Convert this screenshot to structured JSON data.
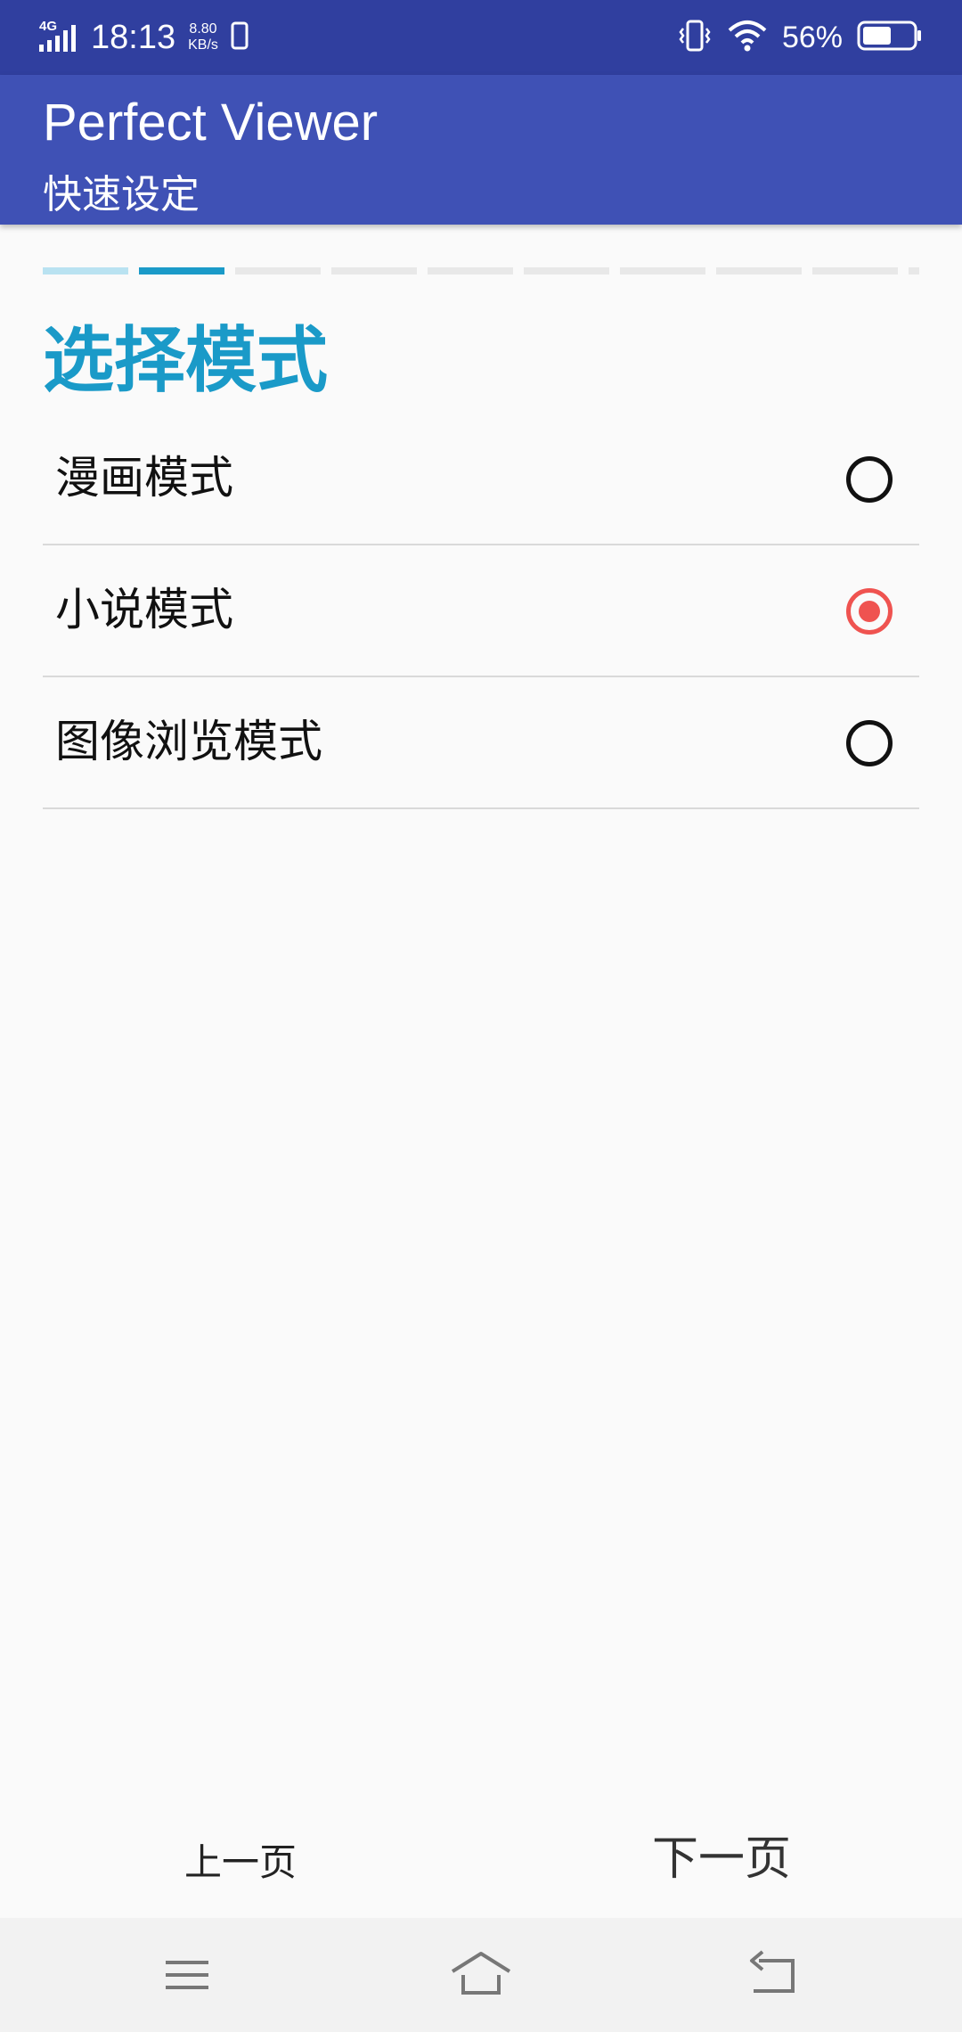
{
  "status_bar": {
    "network": "4G",
    "time": "18:13",
    "net_speed_value": "8.80",
    "net_speed_unit": "KB/s",
    "battery_percent": "56%",
    "battery_level": 0.56,
    "icons": [
      "signal-icon",
      "sim-card-icon",
      "vibrate-icon",
      "wifi-icon",
      "battery-icon"
    ]
  },
  "app_bar": {
    "title": "Perfect Viewer",
    "subtitle": "快速设定"
  },
  "wizard": {
    "total_steps": 9,
    "current_step": 2,
    "accent_color": "#1a9ac8"
  },
  "section": {
    "title": "选择模式"
  },
  "options": [
    {
      "label": "漫画模式",
      "selected": false
    },
    {
      "label": "小说模式",
      "selected": true
    },
    {
      "label": "图像浏览模式",
      "selected": false
    }
  ],
  "footer": {
    "prev_label": "上一页",
    "next_label": "下一页"
  },
  "nav_bar": {
    "icons": [
      "menu-icon",
      "home-icon",
      "back-icon"
    ]
  }
}
